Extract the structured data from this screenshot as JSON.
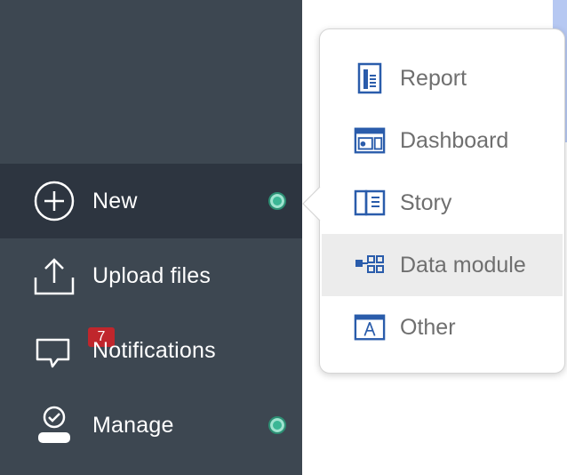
{
  "sidebar": {
    "items": [
      {
        "label": "New",
        "icon": "plus-circle-icon",
        "active": true,
        "indicator": true
      },
      {
        "label": "Upload files",
        "icon": "upload-icon"
      },
      {
        "label": "Notifications",
        "icon": "chat-icon",
        "badge": "7"
      },
      {
        "label": "Manage",
        "icon": "user-check-icon",
        "indicator": true
      }
    ]
  },
  "new_menu": {
    "items": [
      {
        "label": "Report",
        "icon": "report-icon"
      },
      {
        "label": "Dashboard",
        "icon": "dashboard-icon"
      },
      {
        "label": "Story",
        "icon": "story-icon"
      },
      {
        "label": "Data module",
        "icon": "data-module-icon",
        "hovered": true
      },
      {
        "label": "Other",
        "icon": "other-icon"
      }
    ]
  },
  "colors": {
    "sidebar": "#3d4751",
    "sidebar_active": "#2d3540",
    "indicator": "#3bb695",
    "badge": "#c0262c",
    "icon_blue": "#2a5cab"
  }
}
